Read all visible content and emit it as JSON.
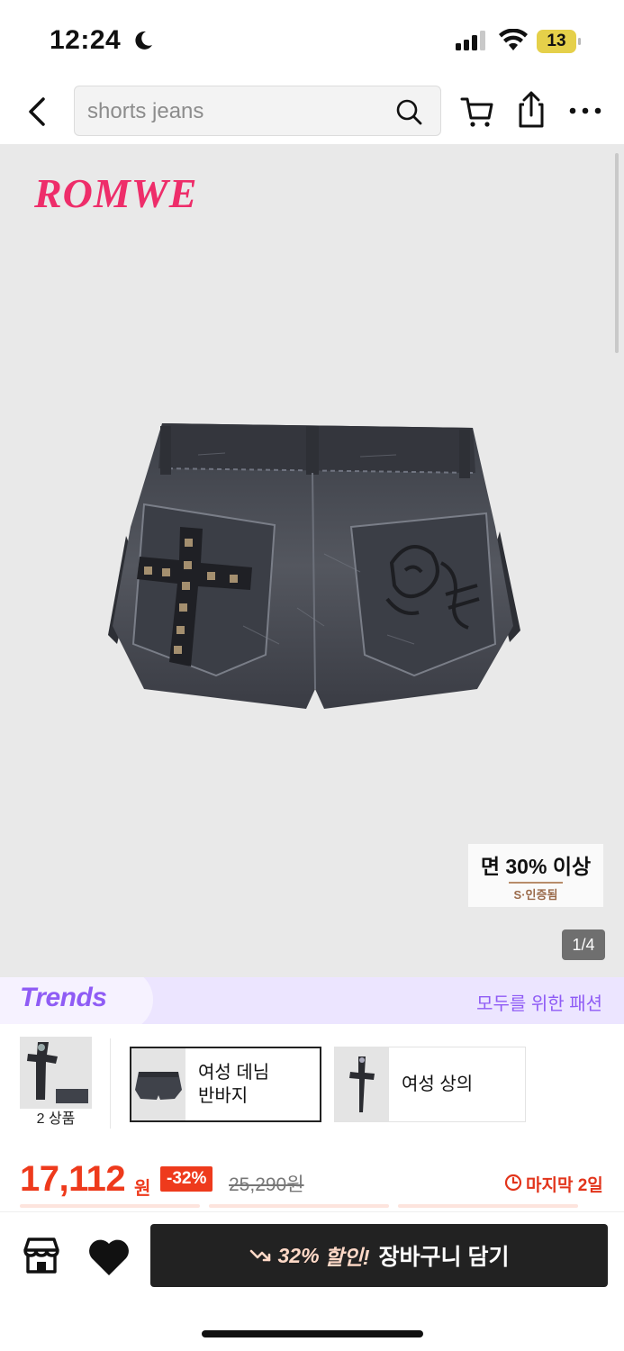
{
  "status_bar": {
    "time": "12:24",
    "battery": "13"
  },
  "nav": {
    "search_value": "shorts jeans"
  },
  "gallery": {
    "brand": "ROMWE",
    "badge_main": "면 30% 이상",
    "badge_sub": "S·인증됨",
    "page_counter": "1/4"
  },
  "trends": {
    "logo": "Trends",
    "tagline": "모두를 위한 패션"
  },
  "related": {
    "first_label": "2 상품",
    "cards": [
      {
        "label": "여성 데님\n반바지",
        "selected": true
      },
      {
        "label": "여성 상의",
        "selected": false
      }
    ]
  },
  "price": {
    "current": "17,112",
    "currency": "원",
    "discount": "-32%",
    "original": "25,290원",
    "countdown": "마지막 2일"
  },
  "bottom_bar": {
    "discount_pct": "32%",
    "discount_word": "할인!",
    "action": "장바구니 담기"
  },
  "colors": {
    "accent": "#ee3a1c",
    "brand": "#ee2d6a",
    "trends": "#8f5cf5",
    "cta_bg": "#222222"
  }
}
